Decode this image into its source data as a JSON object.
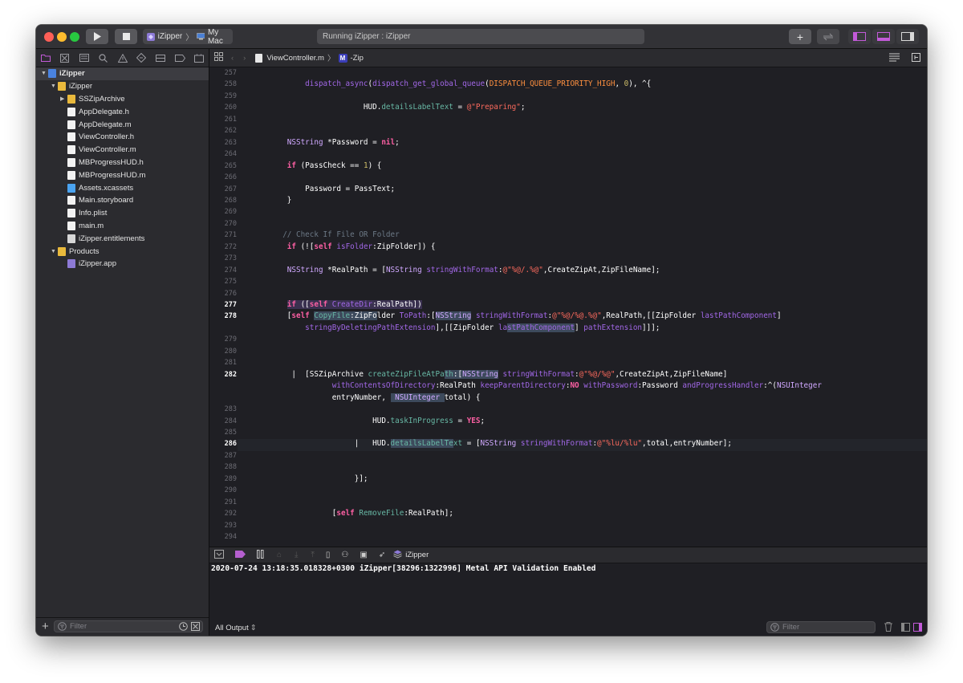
{
  "toolbar": {
    "scheme_target": "iZipper",
    "scheme_device": "My Mac",
    "activity_status": "Running iZipper : iZipper",
    "accent": "#b55fcf"
  },
  "navigator": {
    "items": [
      {
        "label": "iZipper",
        "kind": "project",
        "depth": 0,
        "disclosure": "open",
        "selected": true
      },
      {
        "label": "iZipper",
        "kind": "folder",
        "depth": 1,
        "disclosure": "open"
      },
      {
        "label": "SSZipArchive",
        "kind": "folder",
        "depth": 2,
        "disclosure": "closed"
      },
      {
        "label": "AppDelegate.h",
        "kind": "h",
        "depth": 2
      },
      {
        "label": "AppDelegate.m",
        "kind": "m",
        "depth": 2
      },
      {
        "label": "ViewController.h",
        "kind": "h",
        "depth": 2
      },
      {
        "label": "ViewController.m",
        "kind": "m",
        "depth": 2
      },
      {
        "label": "MBProgressHUD.h",
        "kind": "h",
        "depth": 2
      },
      {
        "label": "MBProgressHUD.m",
        "kind": "m",
        "depth": 2
      },
      {
        "label": "Assets.xcassets",
        "kind": "assets",
        "depth": 2
      },
      {
        "label": "Main.storyboard",
        "kind": "storyboard",
        "depth": 2
      },
      {
        "label": "Info.plist",
        "kind": "plist",
        "depth": 2
      },
      {
        "label": "main.m",
        "kind": "m",
        "depth": 2
      },
      {
        "label": "iZipper.entitlements",
        "kind": "entitlements",
        "depth": 2
      },
      {
        "label": "Products",
        "kind": "folder",
        "depth": 1,
        "disclosure": "open"
      },
      {
        "label": "iZipper.app",
        "kind": "app",
        "depth": 2
      }
    ],
    "filter_placeholder": "Filter"
  },
  "editor": {
    "file": "ViewController.m",
    "symbol_badge": "M",
    "symbol": "-Zip",
    "current_lines": [
      "277",
      "278",
      "282",
      "286"
    ],
    "lines": [
      {
        "n": "257",
        "segs": []
      },
      {
        "n": "258",
        "segs": [
          [
            "",
            "            "
          ],
          [
            "fn",
            "dispatch_async"
          ],
          [
            "",
            "("
          ],
          [
            "fn",
            "dispatch_get_global_queue"
          ],
          [
            "",
            "("
          ],
          [
            "mc",
            "DISPATCH_QUEUE_PRIORITY_HIGH"
          ],
          [
            "",
            ", "
          ],
          [
            "nm",
            "0"
          ],
          [
            "",
            "), ^{"
          ]
        ]
      },
      {
        "n": "259",
        "segs": []
      },
      {
        "n": "260",
        "segs": [
          [
            "",
            "                         HUD."
          ],
          [
            "fn2",
            "detailsLabelText"
          ],
          [
            "",
            " = "
          ],
          [
            "st",
            "@\"Preparing\""
          ],
          [
            "",
            ";"
          ]
        ]
      },
      {
        "n": "261",
        "segs": []
      },
      {
        "n": "262",
        "segs": []
      },
      {
        "n": "263",
        "segs": [
          [
            "",
            "        "
          ],
          [
            "ty",
            "NSString"
          ],
          [
            "",
            " *Password = "
          ],
          [
            "k",
            "nil"
          ],
          [
            "",
            ";"
          ]
        ]
      },
      {
        "n": "264",
        "segs": []
      },
      {
        "n": "265",
        "segs": [
          [
            "",
            "        "
          ],
          [
            "k",
            "if"
          ],
          [
            "",
            " (PassCheck == "
          ],
          [
            "nm",
            "1"
          ],
          [
            "",
            ") {"
          ]
        ]
      },
      {
        "n": "266",
        "segs": []
      },
      {
        "n": "267",
        "segs": [
          [
            "",
            "            Password = PassText;"
          ]
        ]
      },
      {
        "n": "268",
        "segs": [
          [
            "",
            "        }"
          ]
        ]
      },
      {
        "n": "269",
        "segs": []
      },
      {
        "n": "270",
        "segs": []
      },
      {
        "n": "271",
        "segs": [
          [
            "",
            "       "
          ],
          [
            "cm",
            "// Check If File OR Folder"
          ]
        ]
      },
      {
        "n": "272",
        "segs": [
          [
            "",
            "        "
          ],
          [
            "k",
            "if"
          ],
          [
            "",
            " (!["
          ],
          [
            "k",
            "self"
          ],
          [
            "",
            " "
          ],
          [
            "fn",
            "isFolder"
          ],
          [
            "",
            ":ZipFolder]) {"
          ]
        ]
      },
      {
        "n": "273",
        "segs": []
      },
      {
        "n": "274",
        "segs": [
          [
            "",
            "        "
          ],
          [
            "ty",
            "NSString"
          ],
          [
            "",
            " *RealPath = ["
          ],
          [
            "ty",
            "NSString"
          ],
          [
            "",
            " "
          ],
          [
            "fn",
            "stringWithFormat"
          ],
          [
            "",
            ":"
          ],
          [
            "st",
            "@\"%@/.%@\""
          ],
          [
            "",
            ",CreateZipAt,ZipFileName];"
          ]
        ]
      },
      {
        "n": "275",
        "segs": []
      },
      {
        "n": "276",
        "segs": []
      },
      {
        "n": "277",
        "segs": [
          [
            "",
            "        "
          ],
          [
            "k hlk",
            "if"
          ],
          [
            "hlk",
            " (["
          ],
          [
            "k hlk",
            "self"
          ],
          [
            "hlk",
            " "
          ],
          [
            "fn hlk",
            "CreateDir"
          ],
          [
            "hlk",
            ":RealPath])"
          ]
        ]
      },
      {
        "n": "278",
        "segs": [
          [
            "",
            "        ["
          ],
          [
            "k",
            "self"
          ],
          [
            "",
            " "
          ],
          [
            "fn2 hlb",
            "CopyFile"
          ],
          [
            "hlb",
            ":ZipFo"
          ],
          [
            "",
            "lder "
          ],
          [
            "fn",
            "ToPath"
          ],
          [
            "",
            ":["
          ],
          [
            "ty hlb",
            "NSString"
          ],
          [
            "",
            " "
          ],
          [
            "fn",
            "stringWithFormat"
          ],
          [
            "",
            ":"
          ],
          [
            "st",
            "@\"%@/%@.%@\""
          ],
          [
            "",
            ",RealPath,[[ZipFolder "
          ],
          [
            "fn",
            "lastPathComponent"
          ],
          [
            "",
            "]"
          ]
        ]
      },
      {
        "n": "",
        "segs": [
          [
            "",
            "            "
          ],
          [
            "fn",
            "stringByDeletingPathExtension"
          ],
          [
            "",
            "],[[ZipFolder "
          ],
          [
            "fn",
            "la"
          ],
          [
            "fn hlb",
            "stPathComponent"
          ],
          [
            "",
            "] "
          ],
          [
            "fn",
            "pathExtension"
          ],
          [
            "",
            "]]];"
          ]
        ]
      },
      {
        "n": "279",
        "segs": []
      },
      {
        "n": "280",
        "segs": []
      },
      {
        "n": "281",
        "segs": []
      },
      {
        "n": "282",
        "segs": [
          [
            "",
            "         |  [SSZipArchive "
          ],
          [
            "fn2",
            "createZipFileAtPa"
          ],
          [
            "fn2 hlb",
            "th"
          ],
          [
            "hlb",
            ":["
          ],
          [
            "ty hlb",
            "NSString"
          ],
          [
            "",
            " "
          ],
          [
            "fn",
            "stringWithFormat"
          ],
          [
            "",
            ":"
          ],
          [
            "st",
            "@\"%@/%@\""
          ],
          [
            "",
            ",CreateZipAt,ZipFileName]"
          ]
        ]
      },
      {
        "n": "",
        "segs": [
          [
            "",
            "                  "
          ],
          [
            "fn",
            "withContentsOfDirectory"
          ],
          [
            "",
            ":RealPath "
          ],
          [
            "fn",
            "keepParentDirectory"
          ],
          [
            "",
            ":"
          ],
          [
            "k",
            "NO"
          ],
          [
            "",
            " "
          ],
          [
            "fn",
            "withPassword"
          ],
          [
            "",
            ":Password "
          ],
          [
            "fn",
            "andProgressHandler"
          ],
          [
            "",
            ":^("
          ],
          [
            "ty",
            "NSUInteger"
          ]
        ]
      },
      {
        "n": "",
        "segs": [
          [
            "",
            "                  entryNumber, "
          ],
          [
            "ty hlb",
            " NSUInteger "
          ],
          [
            "",
            "total) {"
          ]
        ]
      },
      {
        "n": "283",
        "segs": []
      },
      {
        "n": "284",
        "segs": [
          [
            "",
            "                           HUD."
          ],
          [
            "fn2",
            "taskInProgress"
          ],
          [
            "",
            " = "
          ],
          [
            "k",
            "YES"
          ],
          [
            "",
            ";"
          ]
        ]
      },
      {
        "n": "285",
        "segs": []
      },
      {
        "n": "286",
        "segs": [
          [
            "",
            "                       |   HUD."
          ],
          [
            "fn2 hlb",
            "detailsLabelTe"
          ],
          [
            "fn2",
            "xt"
          ],
          [
            "",
            " = ["
          ],
          [
            "ty",
            "NSString"
          ],
          [
            "",
            " "
          ],
          [
            "fn",
            "stringWithFormat"
          ],
          [
            "",
            ":"
          ],
          [
            "st",
            "@\"%lu/%lu\""
          ],
          [
            "",
            ",total,entryNumber];"
          ]
        ]
      },
      {
        "n": "287",
        "segs": []
      },
      {
        "n": "288",
        "segs": []
      },
      {
        "n": "289",
        "segs": [
          [
            "",
            "                       }];"
          ]
        ]
      },
      {
        "n": "290",
        "segs": []
      },
      {
        "n": "291",
        "segs": []
      },
      {
        "n": "292",
        "segs": [
          [
            "",
            "                  ["
          ],
          [
            "k",
            "self"
          ],
          [
            "",
            " "
          ],
          [
            "fn2",
            "RemoveFile"
          ],
          [
            "",
            ":RealPath];"
          ]
        ]
      },
      {
        "n": "293",
        "segs": []
      },
      {
        "n": "294",
        "segs": []
      }
    ]
  },
  "debug": {
    "process": "iZipper",
    "console_line": "2020-07-24 13:18:35.018328+0300 iZipper[38296:1322996] Metal API Validation Enabled",
    "output_selector": "All Output",
    "filter_placeholder": "Filter"
  }
}
